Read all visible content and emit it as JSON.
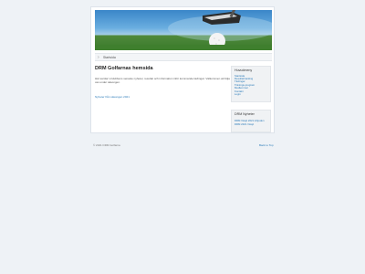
{
  "banner": {
    "image": "golf-club-and-ball-photo"
  },
  "nav": {
    "arrow_icon": "chevron-right-icon",
    "item": "Startsida"
  },
  "main": {
    "title": "DRM Golfarnas hemsida",
    "text": "Här samlar vi klubbens senaste nyheter, resultat och information inför kommande tävlingar. Välkommen att följa oss under säsongen.",
    "link": "Nyheter från säsongen 2021"
  },
  "sidebar": {
    "menu_title": "Huvudmeny",
    "menu_items": [
      "Startsida",
      "Resultat/ranking",
      "Tävlingar",
      "Tränings-program",
      "Medlemmar",
      "Kontakt",
      "Login"
    ],
    "news_title": "DRM Nyheter",
    "news_items": [
      "DRM Växjö 2021 inbjuden",
      "DRM 2021 Växjö"
    ]
  },
  "footer": {
    "copyright": "© 2021 DRM Golfarna",
    "back_to_top": "Back to Top"
  }
}
